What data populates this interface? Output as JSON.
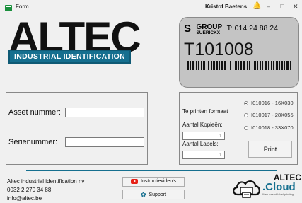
{
  "window": {
    "title": "Form",
    "user": "Kristof Baetens",
    "controls": {
      "minimize": "–",
      "maximize": "□",
      "close": "✕"
    }
  },
  "logo": {
    "word": "ALTEC",
    "tagline": "INDUSTRIAL IDENTIFICATION"
  },
  "label_preview": {
    "group_logo": "S",
    "group_name": "GROUP",
    "group_sub": "SUERICKX",
    "phone": "T: 014 24 88 24",
    "label_id": "T101008"
  },
  "asset_form": {
    "asset_label": "Asset nummer:",
    "asset_value": "",
    "serial_label": "Serienummer:",
    "serial_value": ""
  },
  "print_panel": {
    "format_label": "Te printen formaat",
    "copies_label": "Aantal Kopieën:",
    "copies_value": "1",
    "labels_label": "Aantal Labels:",
    "labels_value": "1",
    "formats": [
      {
        "label": "I010016 - 16X030",
        "selected": true
      },
      {
        "label": "I010017 - 28X055",
        "selected": false
      },
      {
        "label": "I010018 - 33X070",
        "selected": false
      }
    ],
    "print_label": "Print"
  },
  "footer": {
    "company": "Altec industrial identification nv",
    "phone": "0032 2 270 34 88",
    "email": "info@altec.be",
    "video_button": "Instructievideo's",
    "support_button": "Support",
    "cloud_brand_top": "ALTEC",
    "cloud_brand_name": ".Cloud",
    "cloud_tagline": "Web based label printing"
  },
  "colors": {
    "accent": "#156f8f",
    "label_bg": "#c4c4c4",
    "window_bg": "#f0f0f0"
  },
  "icons": [
    "app-form-icon",
    "bell-icon",
    "youtube-icon",
    "gear-icon",
    "cloud-icon"
  ]
}
